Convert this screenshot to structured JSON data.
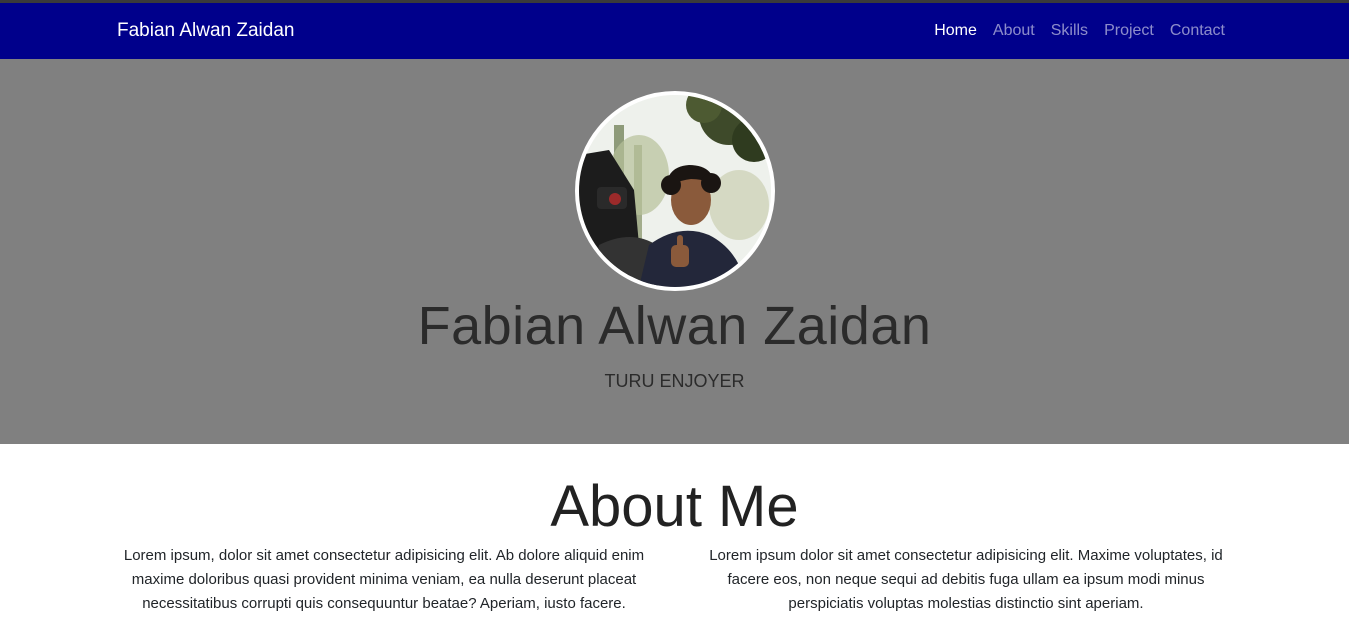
{
  "navbar": {
    "brand": "Fabian Alwan Zaidan",
    "links": [
      {
        "label": "Home",
        "active": true
      },
      {
        "label": "About",
        "active": false
      },
      {
        "label": "Skills",
        "active": false
      },
      {
        "label": "Project",
        "active": false
      },
      {
        "label": "Contact",
        "active": false
      }
    ]
  },
  "hero": {
    "name": "Fabian Alwan Zaidan",
    "tagline": "TURU ENJOYER",
    "avatar_icon": "profile-photo"
  },
  "about": {
    "title": "About Me",
    "paragraphs": [
      "Lorem ipsum, dolor sit amet consectetur adipisicing elit. Ab dolore aliquid enim maxime doloribus quasi provident minima veniam, ea nulla deserunt placeat necessitatibus corrupti quis consequuntur beatae? Aperiam, iusto facere.",
      "Lorem ipsum dolor sit amet consectetur adipisicing elit. Maxime voluptates, id facere eos, non neque sequi ad debitis fuga ullam ea ipsum modi minus perspiciatis voluptas molestias distinctio sint aperiam."
    ]
  },
  "colors": {
    "navbar_bg": "#00008b",
    "hero_bg": "#808080",
    "text_dark": "#2b2b2b"
  }
}
